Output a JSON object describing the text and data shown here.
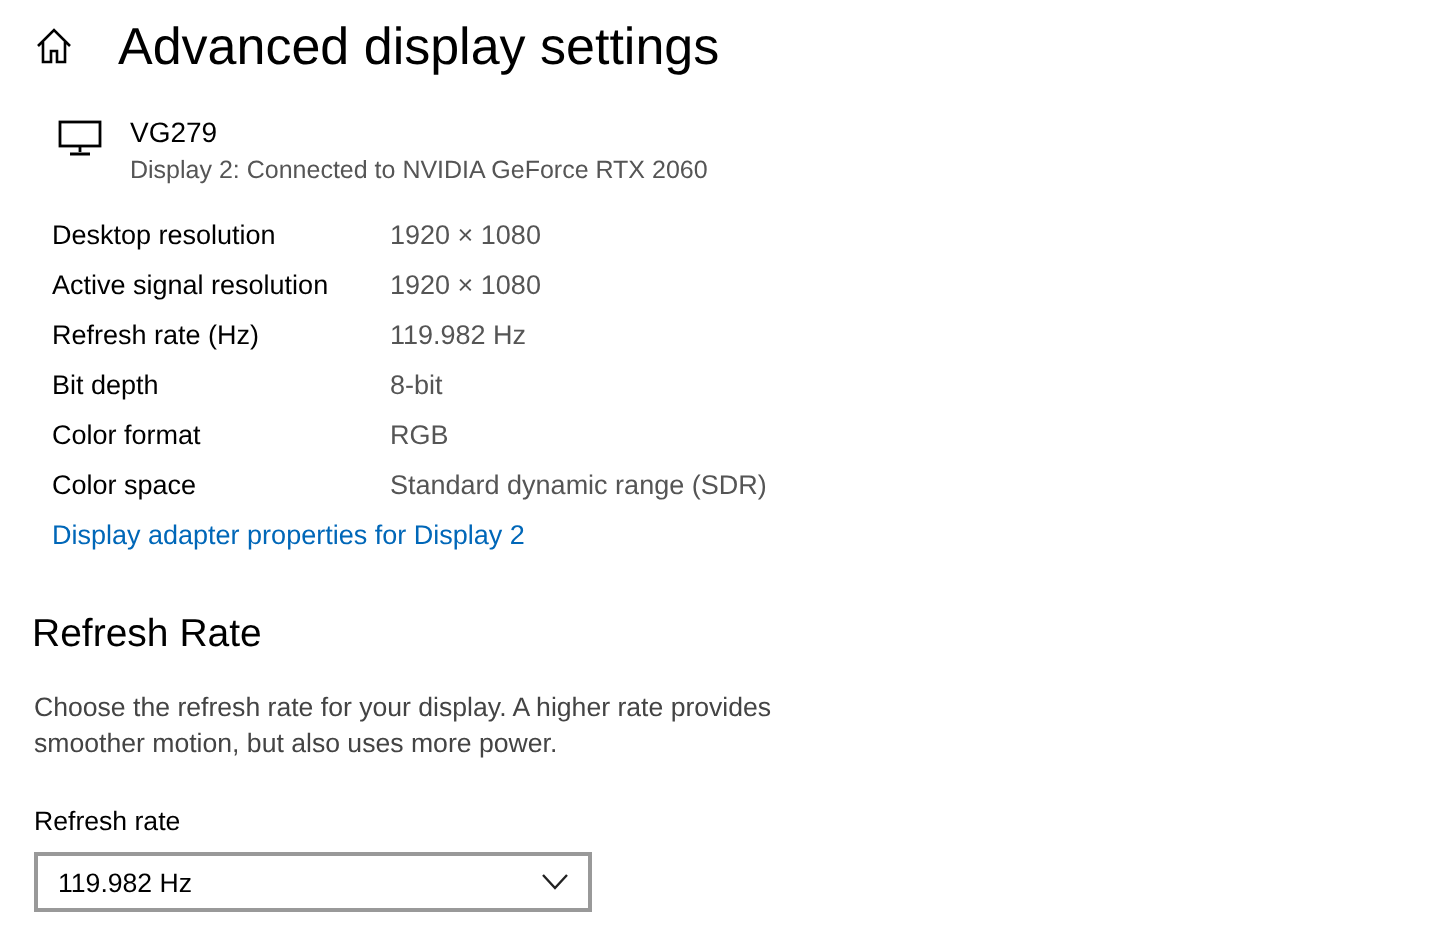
{
  "page": {
    "title": "Advanced display settings"
  },
  "display": {
    "name": "VG279",
    "subtitle": "Display 2: Connected to NVIDIA GeForce RTX 2060"
  },
  "info_rows": [
    {
      "label": "Desktop resolution",
      "value": "1920 × 1080"
    },
    {
      "label": "Active signal resolution",
      "value": "1920 × 1080"
    },
    {
      "label": "Refresh rate (Hz)",
      "value": "119.982 Hz"
    },
    {
      "label": "Bit depth",
      "value": "8-bit"
    },
    {
      "label": "Color format",
      "value": "RGB"
    },
    {
      "label": "Color space",
      "value": "Standard dynamic range (SDR)"
    }
  ],
  "adapter_link": "Display adapter properties for Display 2",
  "refresh_section": {
    "heading": "Refresh Rate",
    "description": "Choose the refresh rate for your display. A higher rate provides smoother motion, but also uses more power.",
    "field_label": "Refresh rate",
    "dropdown_value": "119.982 Hz"
  }
}
